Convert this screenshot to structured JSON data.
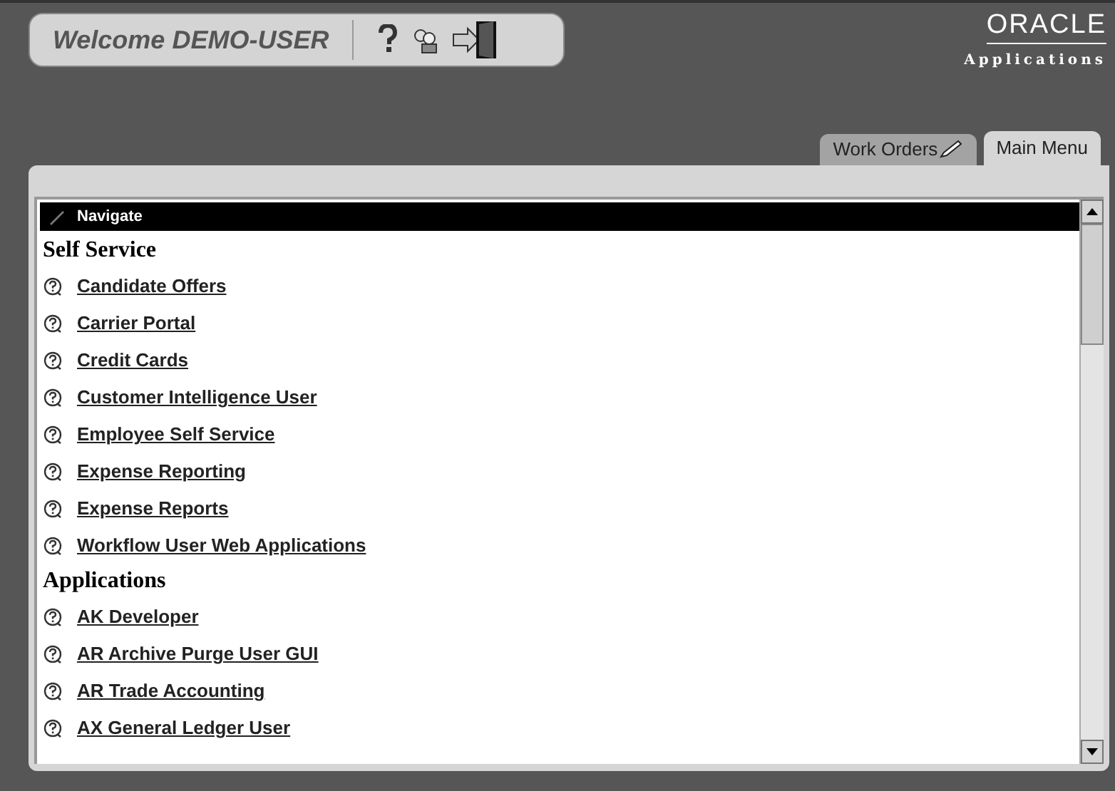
{
  "header": {
    "welcome": "Welcome DEMO-USER"
  },
  "logo": {
    "brand": "ORACLE",
    "product": "Applications"
  },
  "tabs": [
    {
      "label": "Work Orders",
      "selected": false,
      "editable": true
    },
    {
      "label": "Main Menu",
      "selected": true,
      "editable": false
    }
  ],
  "navigate_bar": {
    "title": "Navigate"
  },
  "sections": [
    {
      "title": "Self Service",
      "items": [
        "Candidate Offers",
        "Carrier Portal",
        "Credit Cards",
        "Customer Intelligence User",
        "Employee Self Service",
        "Expense Reporting",
        "Expense Reports",
        "Workflow User Web Applications"
      ]
    },
    {
      "title": "Applications",
      "items": [
        "AK Developer",
        "AR Archive Purge User GUI",
        "AR Trade Accounting",
        "AX General Ledger User"
      ]
    }
  ]
}
